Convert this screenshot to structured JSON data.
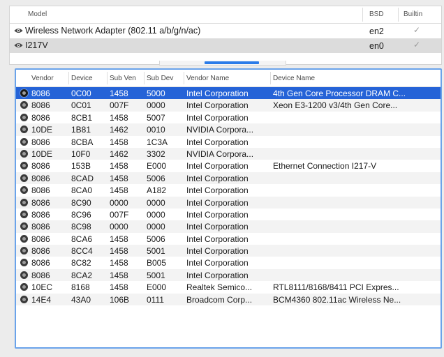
{
  "network_table": {
    "headers": {
      "model": "Model",
      "bsd": "BSD",
      "builtin": "Builtin"
    },
    "rows": [
      {
        "model": "Wireless Network Adapter (802.11 a/b/g/n/ac)",
        "bsd": "en2",
        "builtin": "✓",
        "icon": "eye-icon"
      },
      {
        "model": "I217V",
        "bsd": "en0",
        "builtin": "✓",
        "icon": "eye-icon"
      }
    ]
  },
  "pci_table": {
    "headers": {
      "vendor": "Vendor",
      "device": "Device",
      "sub_ven": "Sub Ven",
      "sub_dev": "Sub Dev",
      "vendor_name": "Vendor Name",
      "device_name": "Device Name"
    },
    "rows": [
      {
        "vendor": "8086",
        "device": "0C00",
        "sub_ven": "1458",
        "sub_dev": "5000",
        "vendor_name": "Intel Corporation",
        "device_name": "4th Gen Core Processor DRAM C..."
      },
      {
        "vendor": "8086",
        "device": "0C01",
        "sub_ven": "007F",
        "sub_dev": "0000",
        "vendor_name": "Intel Corporation",
        "device_name": "Xeon E3-1200 v3/4th Gen Core..."
      },
      {
        "vendor": "8086",
        "device": "8CB1",
        "sub_ven": "1458",
        "sub_dev": "5007",
        "vendor_name": "Intel Corporation",
        "device_name": ""
      },
      {
        "vendor": "10DE",
        "device": "1B81",
        "sub_ven": "1462",
        "sub_dev": "0010",
        "vendor_name": "NVIDIA Corpora...",
        "device_name": ""
      },
      {
        "vendor": "8086",
        "device": "8CBA",
        "sub_ven": "1458",
        "sub_dev": "1C3A",
        "vendor_name": "Intel Corporation",
        "device_name": ""
      },
      {
        "vendor": "10DE",
        "device": "10F0",
        "sub_ven": "1462",
        "sub_dev": "3302",
        "vendor_name": "NVIDIA Corpora...",
        "device_name": ""
      },
      {
        "vendor": "8086",
        "device": "153B",
        "sub_ven": "1458",
        "sub_dev": "E000",
        "vendor_name": "Intel Corporation",
        "device_name": "Ethernet Connection I217-V"
      },
      {
        "vendor": "8086",
        "device": "8CAD",
        "sub_ven": "1458",
        "sub_dev": "5006",
        "vendor_name": "Intel Corporation",
        "device_name": ""
      },
      {
        "vendor": "8086",
        "device": "8CA0",
        "sub_ven": "1458",
        "sub_dev": "A182",
        "vendor_name": "Intel Corporation",
        "device_name": ""
      },
      {
        "vendor": "8086",
        "device": "8C90",
        "sub_ven": "0000",
        "sub_dev": "0000",
        "vendor_name": "Intel Corporation",
        "device_name": ""
      },
      {
        "vendor": "8086",
        "device": "8C96",
        "sub_ven": "007F",
        "sub_dev": "0000",
        "vendor_name": "Intel Corporation",
        "device_name": ""
      },
      {
        "vendor": "8086",
        "device": "8C98",
        "sub_ven": "0000",
        "sub_dev": "0000",
        "vendor_name": "Intel Corporation",
        "device_name": ""
      },
      {
        "vendor": "8086",
        "device": "8CA6",
        "sub_ven": "1458",
        "sub_dev": "5006",
        "vendor_name": "Intel Corporation",
        "device_name": ""
      },
      {
        "vendor": "8086",
        "device": "8CC4",
        "sub_ven": "1458",
        "sub_dev": "5001",
        "vendor_name": "Intel Corporation",
        "device_name": ""
      },
      {
        "vendor": "8086",
        "device": "8C82",
        "sub_ven": "1458",
        "sub_dev": "B005",
        "vendor_name": "Intel Corporation",
        "device_name": ""
      },
      {
        "vendor": "8086",
        "device": "8CA2",
        "sub_ven": "1458",
        "sub_dev": "5001",
        "vendor_name": "Intel Corporation",
        "device_name": ""
      },
      {
        "vendor": "10EC",
        "device": "8168",
        "sub_ven": "1458",
        "sub_dev": "E000",
        "vendor_name": "Realtek Semico...",
        "device_name": "RTL8111/8168/8411 PCI Expres..."
      },
      {
        "vendor": "14E4",
        "device": "43A0",
        "sub_ven": "106B",
        "sub_dev": "0111",
        "vendor_name": "Broadcom Corp...",
        "device_name": "BCM4360 802.11ac Wireless Ne..."
      }
    ],
    "selected_row": 0
  },
  "colors": {
    "selection": "#2563d7",
    "focus_ring": "#6aa3ea",
    "tab_indicator": "#2b7ce9"
  }
}
